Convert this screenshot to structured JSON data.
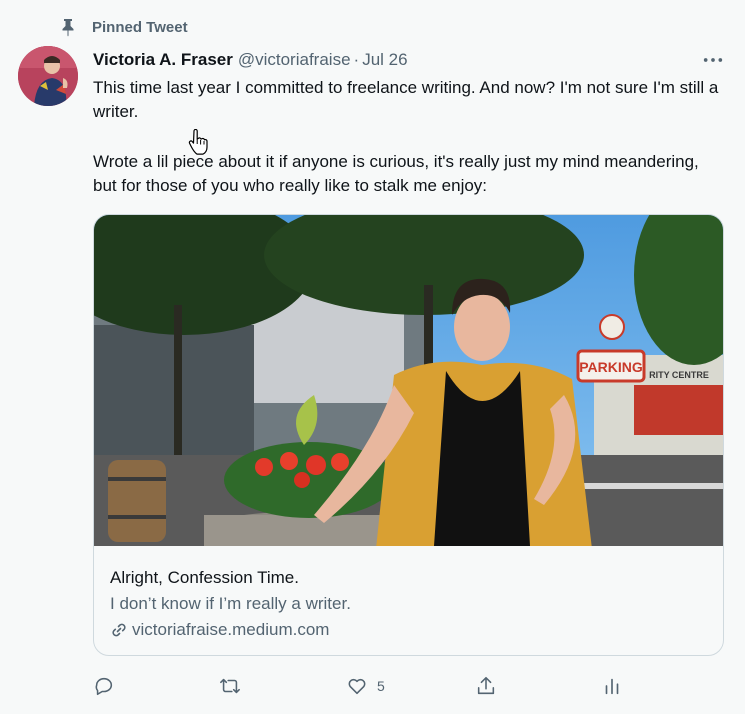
{
  "pinned": {
    "label": "Pinned Tweet",
    "icon": "pin-icon"
  },
  "author": {
    "name": "Victoria A. Fraser",
    "handle": "@victoriafraise",
    "separator": "·",
    "date": "Jul 26",
    "avatar_icon": "avatar"
  },
  "tweet": {
    "paragraph1": "This time last year I committed to freelance writing. And now? I'm not sure I'm still a writer.",
    "paragraph2": "Wrote a lil piece about it if anyone is curious, it's really just my mind meandering, but for those of you who really like to stalk me enjoy:"
  },
  "card": {
    "image_sign": "PARKING",
    "image_sign_small": "RITY CENTRE",
    "title": "Alright, Confession Time.",
    "description": "I don’t know if I’m really a writer.",
    "domain": "victoriafraise.medium.com",
    "domain_icon": "link-icon"
  },
  "actions": {
    "reply_icon": "reply-icon",
    "retweet_icon": "retweet-icon",
    "like_icon": "like-icon",
    "like_count": "5",
    "share_icon": "share-icon",
    "analytics_icon": "analytics-icon"
  },
  "colors": {
    "secondary_text": "#536471",
    "primary_text": "#0f1419",
    "border": "#cfd9de",
    "background": "#f7f9f9"
  }
}
